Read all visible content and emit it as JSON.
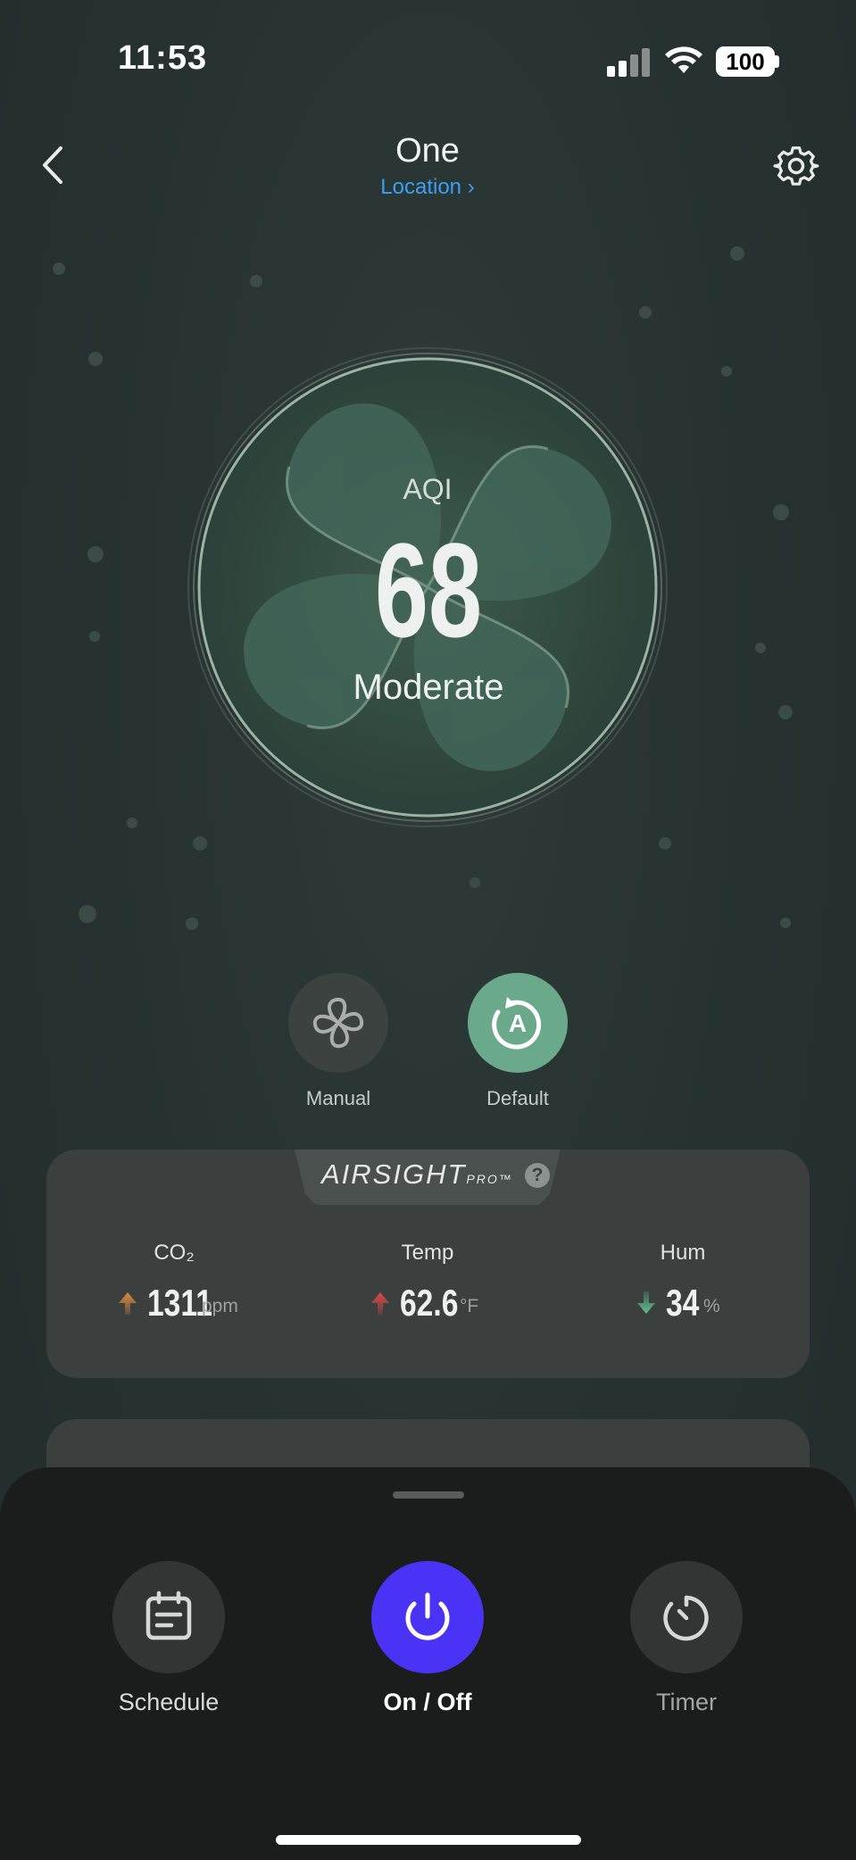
{
  "status_bar": {
    "time": "11:53",
    "battery": "100"
  },
  "header": {
    "title": "One",
    "location_link": "Location",
    "icons": [
      "chevron-left-icon",
      "gear-icon"
    ]
  },
  "aqi": {
    "label": "AQI",
    "value": "68",
    "status": "Moderate"
  },
  "modes": [
    {
      "label": "Manual",
      "icon": "fan-icon",
      "active": false
    },
    {
      "label": "Default",
      "icon": "auto-mode-icon",
      "active": true
    }
  ],
  "airsight": {
    "brand": "AIRSIGHT",
    "brand_sub": "PRO™",
    "metrics": [
      {
        "label": "CO₂",
        "value": "1311",
        "unit": "ppm",
        "trend": "up",
        "trend_color": "#e08a3c"
      },
      {
        "label": "Temp",
        "value": "62.6",
        "unit": "°F",
        "trend": "up",
        "trend_color": "#e04848"
      },
      {
        "label": "Hum",
        "value": "34",
        "unit": "%",
        "trend": "down",
        "trend_color": "#5fbf90"
      }
    ]
  },
  "actions": [
    {
      "label": "Schedule",
      "icon": "calendar-icon"
    },
    {
      "label": "On / Off",
      "icon": "power-icon"
    },
    {
      "label": "Timer",
      "icon": "timer-icon"
    }
  ],
  "colors": {
    "accent": "#4a33f4",
    "mode_active": "#6aa98c",
    "link": "#3a9ff5",
    "background": "#263130"
  }
}
